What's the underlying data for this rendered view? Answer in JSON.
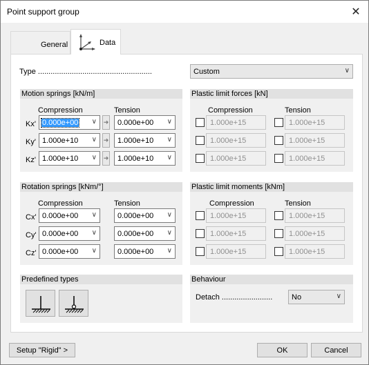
{
  "window": {
    "title": "Point support group"
  },
  "tabs": [
    {
      "label": "General"
    },
    {
      "label": "Data",
      "icon": "axes-icon"
    }
  ],
  "type": {
    "label": "Type ......................................................",
    "value": "Custom"
  },
  "motion": {
    "title": "Motion springs [kN/m]",
    "col_compression": "Compression",
    "col_tension": "Tension",
    "rows": [
      {
        "label": "Kx'",
        "compression": "0.000e+00",
        "tension": "0.000e+00"
      },
      {
        "label": "Ky'",
        "compression": "1.000e+10",
        "tension": "1.000e+10"
      },
      {
        "label": "Kz'",
        "compression": "1.000e+10",
        "tension": "1.000e+10"
      }
    ]
  },
  "plastic_forces": {
    "title": "Plastic limit forces [kN]",
    "col_compression": "Compression",
    "col_tension": "Tension",
    "rows": [
      {
        "compression": "1.000e+15",
        "tension": "1.000e+15"
      },
      {
        "compression": "1.000e+15",
        "tension": "1.000e+15"
      },
      {
        "compression": "1.000e+15",
        "tension": "1.000e+15"
      }
    ]
  },
  "rotation": {
    "title": "Rotation springs [kNm/°]",
    "col_compression": "Compression",
    "col_tension": "Tension",
    "rows": [
      {
        "label": "Cx'",
        "compression": "0.000e+00",
        "tension": "0.000e+00"
      },
      {
        "label": "Cy'",
        "compression": "0.000e+00",
        "tension": "0.000e+00"
      },
      {
        "label": "Cz'",
        "compression": "0.000e+00",
        "tension": "0.000e+00"
      }
    ]
  },
  "plastic_moments": {
    "title": "Plastic limit moments [kNm]",
    "col_compression": "Compression",
    "col_tension": "Tension",
    "rows": [
      {
        "compression": "1.000e+15",
        "tension": "1.000e+15"
      },
      {
        "compression": "1.000e+15",
        "tension": "1.000e+15"
      },
      {
        "compression": "1.000e+15",
        "tension": "1.000e+15"
      }
    ]
  },
  "predefined": {
    "title": "Predefined types"
  },
  "behaviour": {
    "title": "Behaviour",
    "detach_label": "Detach ........................",
    "detach_value": "No"
  },
  "footer": {
    "setup_label": "Setup \"Rigid\" >",
    "ok_label": "OK",
    "cancel_label": "Cancel"
  }
}
